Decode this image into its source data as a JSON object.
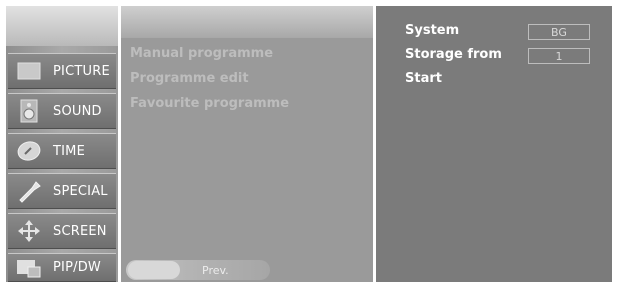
{
  "sidebar": {
    "items": [
      {
        "label": "PICTURE",
        "icon": "picture-icon"
      },
      {
        "label": "SOUND",
        "icon": "sound-icon"
      },
      {
        "label": "TIME",
        "icon": "time-icon"
      },
      {
        "label": "SPECIAL",
        "icon": "special-icon"
      },
      {
        "label": "SCREEN",
        "icon": "screen-icon"
      },
      {
        "label": "PIP/DW",
        "icon": "pip-icon"
      }
    ]
  },
  "menu": {
    "items": [
      "Manual programme",
      "Programme edit",
      "Favourite programme"
    ],
    "prev_label": "Prev."
  },
  "settings": {
    "system_label": "System",
    "system_value": "BG",
    "storage_label": "Storage from",
    "storage_value": "1",
    "start_label": "Start"
  },
  "colors": {
    "right_panel": "#7b7b7b",
    "mid_panel": "#9a9a9a",
    "sidebar_item": "#7a7a7a",
    "text_white": "#ffffff",
    "text_dim": "#bdbdbd"
  }
}
